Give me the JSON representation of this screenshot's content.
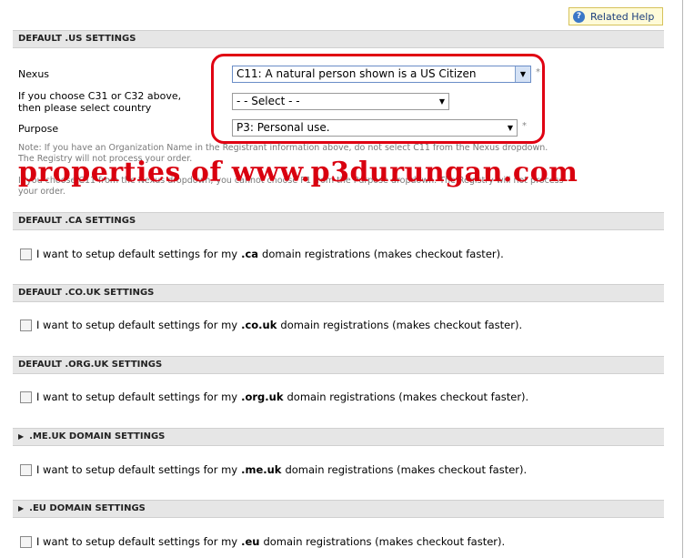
{
  "help": {
    "label": "Related Help"
  },
  "us_section": {
    "title": "DEFAULT .US SETTINGS",
    "nexus_label": "Nexus",
    "nexus_value": "C11: A natural person shown is a US Citizen",
    "country_label_1": "If you choose C31 or C32 above,",
    "country_label_2": "then please select country",
    "country_value": "- - Select - -",
    "purpose_label": "Purpose",
    "purpose_value": "P3: Personal use.",
    "required_mark": "*",
    "note_1": "Note: If you have an Organization Name in the Registrant information above, do not select C11 from the Nexus dropdown.",
    "note_2": "The Registry will not process your order.",
    "note_3": "If you choose C11 from the Nexus dropdown, you cannot choose P1 from the Purpose dropdown. The Registry will not process",
    "note_4": "your order."
  },
  "watermark": "properties of www.p3durungan.com",
  "sections": [
    {
      "title": "DEFAULT .CA SETTINGS",
      "pre": "I want to setup default settings for my",
      "tld": ".ca",
      "post": "domain registrations (makes checkout faster)."
    },
    {
      "title": "DEFAULT .CO.UK SETTINGS",
      "pre": "I want to setup default settings for my",
      "tld": ".co.uk",
      "post": "domain registrations (makes checkout faster)."
    },
    {
      "title": "DEFAULT .ORG.UK SETTINGS",
      "pre": "I want to setup default settings for my",
      "tld": ".org.uk",
      "post": "domain registrations (makes checkout faster)."
    },
    {
      "title": ".ME.UK DOMAIN SETTINGS",
      "pre": "I want to setup default settings for my",
      "tld": ".me.uk",
      "post": "domain registrations (makes checkout faster)."
    },
    {
      "title": ".EU DOMAIN SETTINGS",
      "pre": "I want to setup default settings for my",
      "tld": ".eu",
      "post": "domain registrations (makes checkout faster)."
    }
  ],
  "colors": {
    "annotation_red": "#e00012",
    "section_bg": "#e6e6e6"
  }
}
